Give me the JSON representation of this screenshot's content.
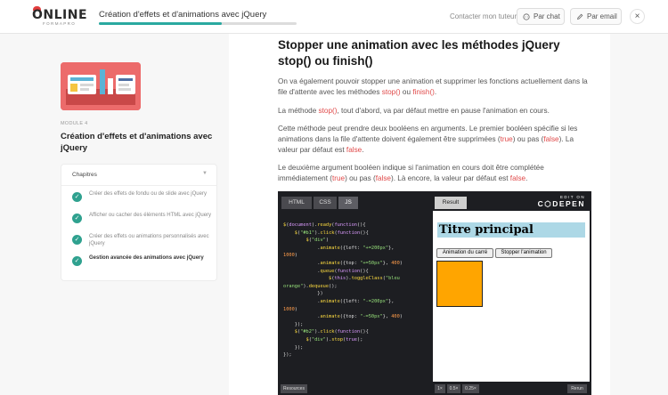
{
  "header": {
    "logo_word": "ONLINE",
    "logo_sub": "FORMAPRO",
    "course_title": "Création d'effets et d'animations avec jQuery",
    "progress": 0.62,
    "contact_label": "Contacter mon tuteur :",
    "chat_label": "Par chat",
    "email_label": "Par email",
    "close_glyph": "×"
  },
  "sidebar": {
    "module_label": "MODULE 4",
    "module_title": "Création d'effets et d'animations avec jQuery",
    "chapters_title": "Chapitres",
    "chapters_caret": "▼",
    "chapters": [
      {
        "label": "Créer des effets de fondu ou de slide avec jQuery",
        "active": false
      },
      {
        "label": "Afficher ou cacher des éléments HTML avec jQuery",
        "active": false
      },
      {
        "label": "Créer des effets ou animations personnalisés avec jQuery",
        "active": false
      },
      {
        "label": "Gestion avancée des animations avec jQuery",
        "active": true
      }
    ]
  },
  "content": {
    "heading": "Stopper une animation avec les méthodes jQuery stop() ou finish()",
    "p1_a": "On va également pouvoir stopper une animation et supprimer les fonctions actuellement dans la file d'attente avec les méthodes ",
    "p1_stop": "stop()",
    "p1_ou": " ou ",
    "p1_finish": "finish()",
    "p1_end": ".",
    "p2_a": "La méthode ",
    "p2_stop": "stop()",
    "p2_b": ", tout d'abord, va par défaut mettre en pause l'animation en cours.",
    "p3_a": "Cette méthode peut prendre deux booléens en arguments. Le premier booléen spécifie si les animations dans la file d'attente doivent également être supprimées (",
    "p3_true": "true",
    "p3_b": ") ou pas (",
    "p3_false": "false",
    "p3_c": "). La valeur par défaut est ",
    "p3_false2": "false",
    "p3_end": ".",
    "p4_a": "Le deuxième argument booléen indique si l'animation en cours doit être complétée immédiatement (",
    "p4_true": "true",
    "p4_b": ") ou pas (",
    "p4_false": "false",
    "p4_c": "). Là encore, la valeur par défaut est ",
    "p4_false2": "false",
    "p4_end": "."
  },
  "codepen": {
    "tabs": [
      "HTML",
      "CSS",
      "JS"
    ],
    "active_tab": "JS",
    "result_tab": "Result",
    "edit_on": "EDIT ON",
    "brand": "C⬡DEPEN",
    "result_title": "Titre principal",
    "btn1": "Animation du carré",
    "btn2": "Stopper l'animation",
    "footer_resources": "Resources",
    "zoom": [
      "1×",
      "0.5×",
      "0.25×"
    ],
    "rerun": "Rerun",
    "box_color": "#ffa500",
    "title_bg": "#add8e6"
  },
  "colors": {
    "accent": "#2aa9a0",
    "keyword": "#e04a4a",
    "check": "#2fa18f",
    "course_img": "#ec6b6b"
  }
}
